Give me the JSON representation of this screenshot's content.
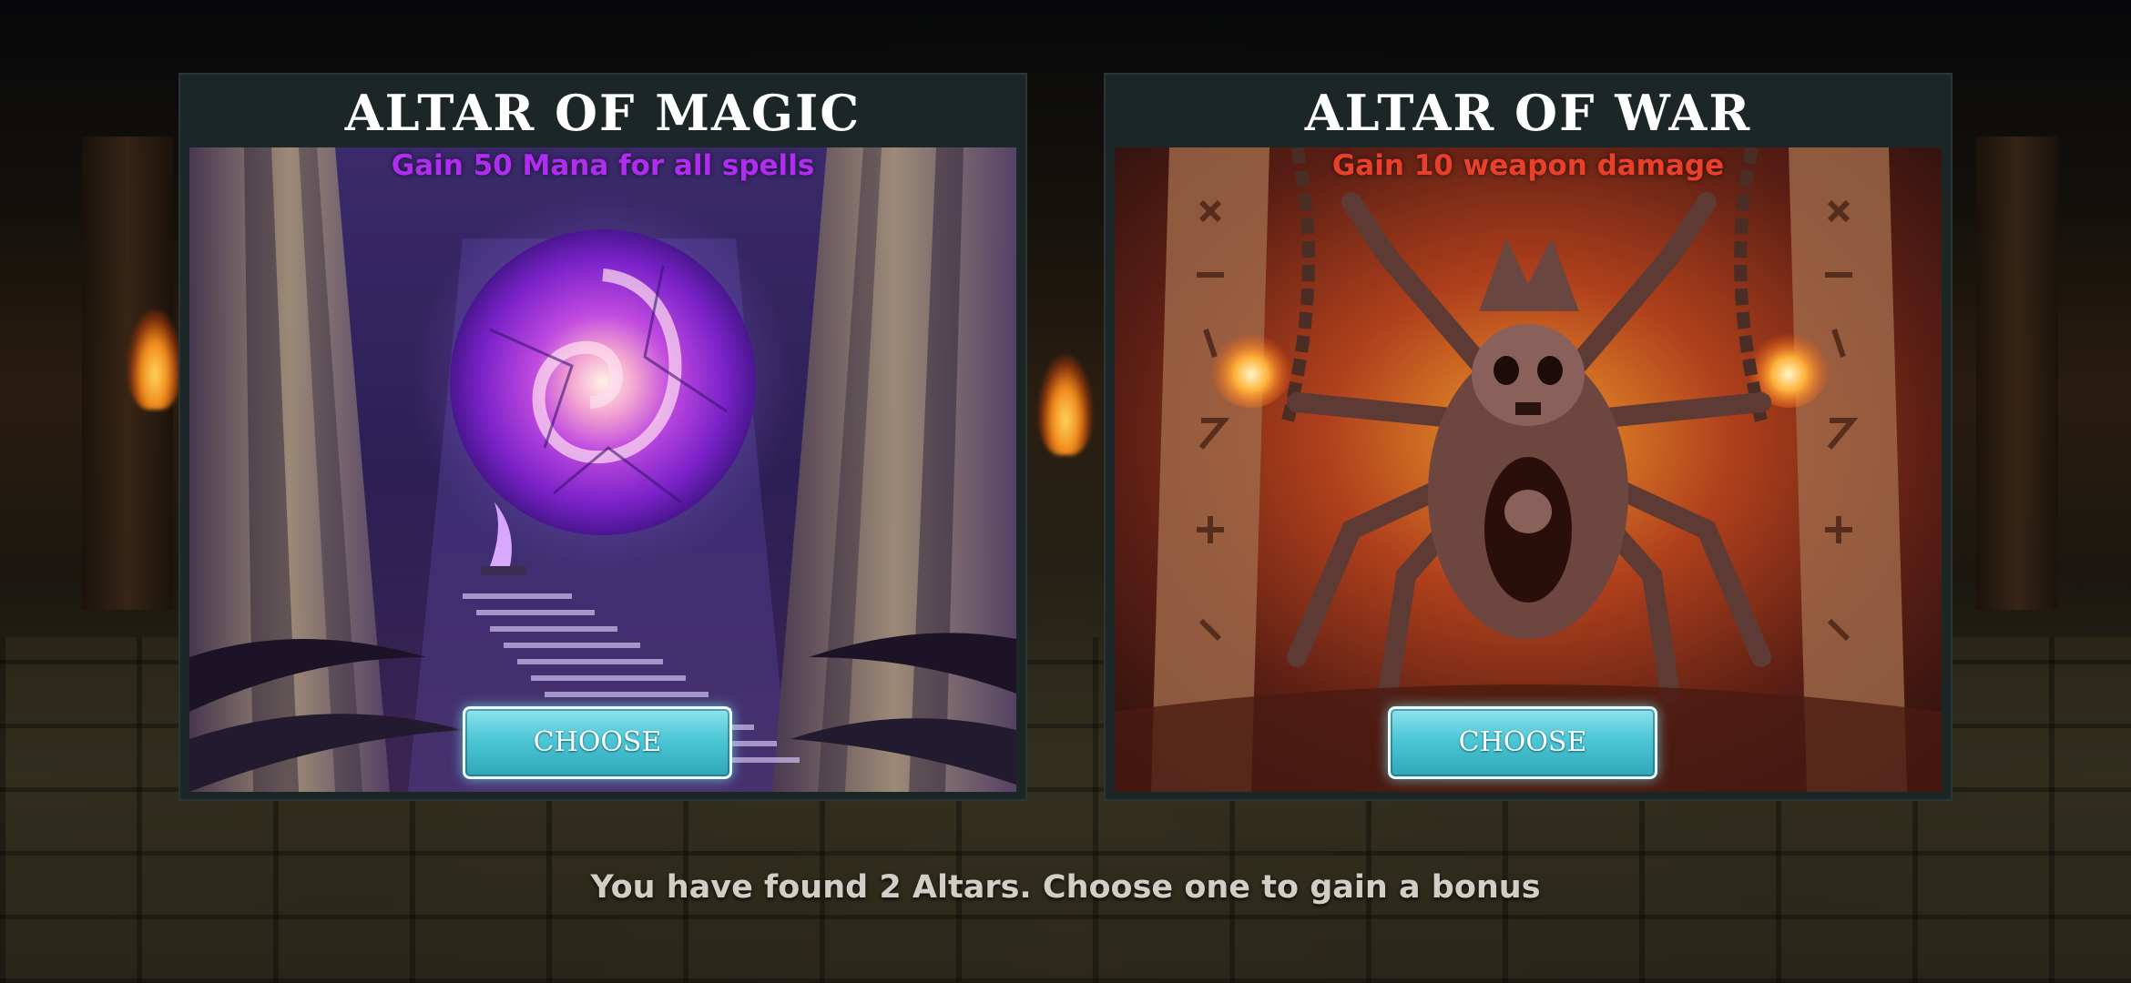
{
  "altars": [
    {
      "title": "ALTAR OF MAGIC",
      "bonus": "Gain 50 Mana for all spells",
      "bonus_color": "#b02cf0",
      "button_label": "CHOOSE",
      "art": "purple-mana-orb-illustration"
    },
    {
      "title": "ALTAR OF WAR",
      "bonus": "Gain 10 weapon damage",
      "bonus_color": "#e8402a",
      "button_label": "CHOOSE",
      "art": "skeletal-demon-illustration"
    }
  ],
  "footer": {
    "message": "You have found 2 Altars. Choose one to gain a bonus"
  },
  "colors": {
    "card_bg": "#1c2626",
    "button_fill": "#4dc6d6",
    "title_text": "#ffffff"
  }
}
